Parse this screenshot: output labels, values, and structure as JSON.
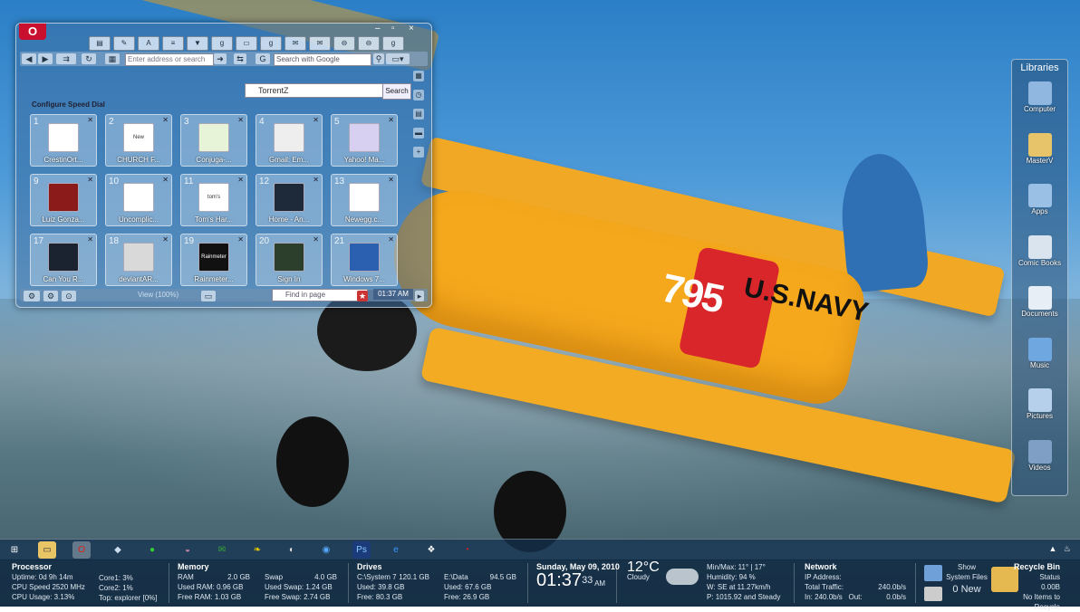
{
  "browser": {
    "address_placeholder": "Enter address or search",
    "search_placeholder": "Search with Google",
    "speeddial_search_value": "TorrentZ",
    "speeddial_search_button": "Search",
    "configure_label": "Configure Speed Dial",
    "view_label": "View (100%)",
    "find_placeholder": "Find in page",
    "clock": "01:37 AM",
    "tiles": [
      {
        "num": "1",
        "label": "CrestinOrt..."
      },
      {
        "num": "2",
        "label": "CHURCH F..."
      },
      {
        "num": "3",
        "label": "Conjuga-..."
      },
      {
        "num": "4",
        "label": "Gmail: Em..."
      },
      {
        "num": "5",
        "label": "Yahoo! Ma..."
      },
      {
        "num": "9",
        "label": "Luiz Gonza..."
      },
      {
        "num": "10",
        "label": "Uncomplic..."
      },
      {
        "num": "11",
        "label": "Tom's Har..."
      },
      {
        "num": "12",
        "label": "Home - An..."
      },
      {
        "num": "13",
        "label": "Newegg.c..."
      },
      {
        "num": "17",
        "label": "Can You R..."
      },
      {
        "num": "18",
        "label": "deviantAR..."
      },
      {
        "num": "19",
        "label": "Rainmeter..."
      },
      {
        "num": "20",
        "label": "Sign In"
      },
      {
        "num": "21",
        "label": "Windows 7..."
      }
    ],
    "thumbs": [
      "",
      "New Advent",
      "",
      "",
      "",
      "",
      "",
      "tom's",
      "",
      "",
      "",
      "",
      "Rainmeter",
      "",
      ""
    ]
  },
  "libraries": {
    "title": "Libraries",
    "items": [
      {
        "label": "Computer",
        "color": "#8fb7e0"
      },
      {
        "label": "MasterV",
        "color": "#e7c46a"
      },
      {
        "label": "Apps",
        "color": "#9ac0e6"
      },
      {
        "label": "Comic Books",
        "color": "#d9e4ef"
      },
      {
        "label": "Documents",
        "color": "#e8eef6"
      },
      {
        "label": "Music",
        "color": "#6fa7e0"
      },
      {
        "label": "Pictures",
        "color": "#b6d0ec"
      },
      {
        "label": "Videos",
        "color": "#7f9fc4"
      }
    ]
  },
  "wallpaper": {
    "number": "795",
    "navy": "U.S.NAVY"
  },
  "info": {
    "processor": {
      "title": "Processor",
      "uptime": "Uptime: 0d 9h 14m",
      "speed": "CPU Speed   2520 MHz",
      "usage": "CPU Usage: 3.13%",
      "core1": "Core1: 3%",
      "core2": "Core2: 1%",
      "top": "Top: explorer [0%]"
    },
    "memory": {
      "title": "Memory",
      "ram": "RAM",
      "ram_val": "2.0 GB",
      "used": "Used RAM: 0.96 GB",
      "free": "Free RAM: 1.03 GB",
      "swap": "Swap",
      "swap_val": "4.0 GB",
      "used_swap": "Used Swap: 1.24 GB",
      "free_swap": "Free Swap: 2.74 GB"
    },
    "drives": {
      "title": "Drives",
      "c": "C:\\System 7",
      "c_val": "120.1 GB",
      "c_used": "Used: 39.8 GB",
      "c_free": "Free: 80.3 GB",
      "e": "E:\\Data",
      "e_val": "94.5 GB",
      "e_used": "Used: 67.6 GB",
      "e_free": "Free: 26.9 GB"
    },
    "clock": {
      "date": "Sunday, May 09, 2010",
      "time": "01:37",
      "sec": "33",
      "ampm": "AM"
    },
    "weather": {
      "temp": "12°C",
      "cond": "Cloudy",
      "minmax": "Min/Max: 11° | 17°",
      "humidity": "Humidity: 94 %",
      "wind": "W: SE at 11.27km/h",
      "pressure": "P: 1015.92 and Steady"
    },
    "network": {
      "title": "Network",
      "ip": "IP Address:",
      "traffic": "Total Traffic:",
      "traffic_val": "240.0b/s",
      "in": "In:   240.0b/s",
      "out": "Out:",
      "out_val": "0.0b/s"
    },
    "files": {
      "show": "Show",
      "system": "System Files",
      "new": "0 New"
    },
    "recycle": {
      "title": "Recycle Bin",
      "status": "Status",
      "size": "0.00B",
      "items": "No Items to Recycle"
    }
  }
}
